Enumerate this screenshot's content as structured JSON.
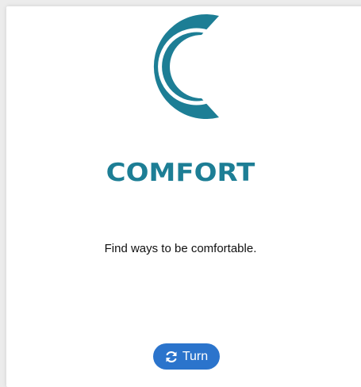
{
  "app": {
    "title": "COMFORT",
    "description": "Find ways to be comfortable.",
    "logo_icon": "comfort-c-logo-icon",
    "brand_color": "#1d7e95"
  },
  "actions": {
    "turn_label": "Turn",
    "turn_icon": "refresh-icon",
    "button_color": "#2b74cc"
  }
}
